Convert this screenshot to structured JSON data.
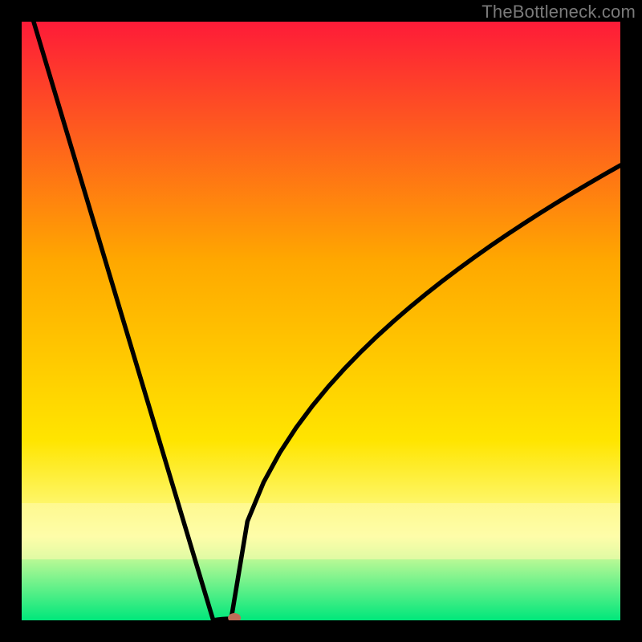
{
  "watermark": "TheBottleneck.com",
  "chart_data": {
    "type": "line",
    "title": "",
    "xlabel": "",
    "ylabel": "",
    "xlim": [
      0,
      1
    ],
    "ylim": [
      0,
      1
    ],
    "minimum_point": {
      "x": 0.35,
      "y": 0.0
    },
    "left_branch": {
      "start": {
        "x": 0.02,
        "y": 1.0
      },
      "end": {
        "x": 0.32,
        "y": 0.0
      }
    },
    "right_branch": {
      "end": {
        "x": 1.0,
        "y": 0.76
      }
    },
    "background_gradient": {
      "top": "#fe1b38",
      "mid_upper": "#ffa800",
      "mid": "#ffe500",
      "light_band": "#fdff9f",
      "bottom": "#00e77b"
    },
    "curve_color": "#000000",
    "marker": {
      "color": "#bf6e58",
      "radius_px": 7
    }
  }
}
